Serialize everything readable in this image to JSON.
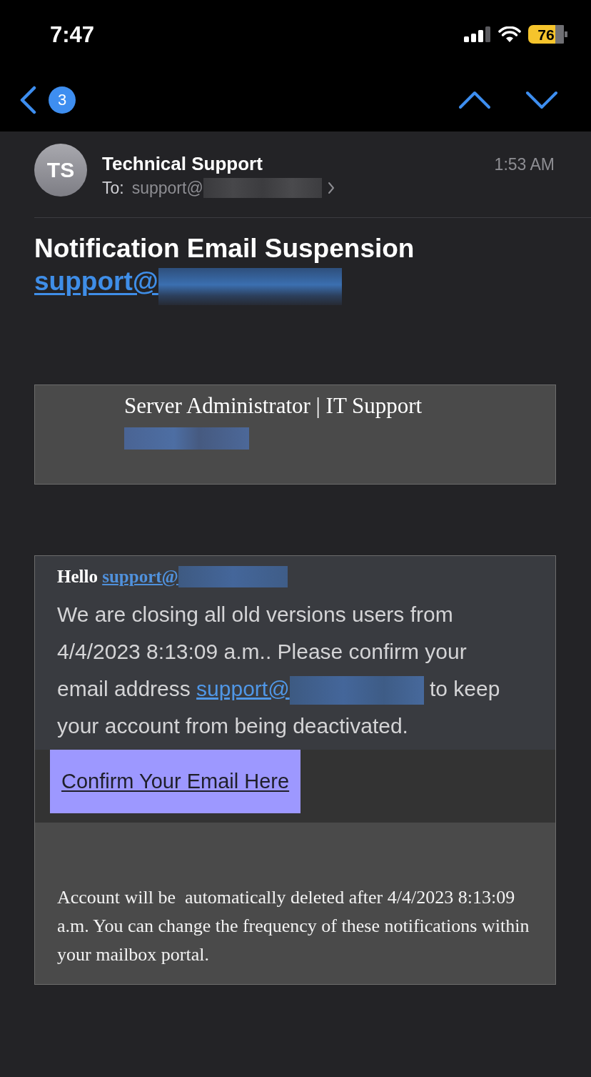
{
  "status_bar": {
    "time": "7:47",
    "battery": "76"
  },
  "nav": {
    "unread_count": "3"
  },
  "message": {
    "sender_initials": "TS",
    "sender": "Technical Support",
    "to_label": "To:",
    "to_address": "support@",
    "time": "1:53 AM",
    "subject": "Notification Email Suspension",
    "subject_link": "support@"
  },
  "body": {
    "banner": "Server Administrator | IT Support",
    "greeting": "Hello ",
    "greeting_link": "support@",
    "notice": {
      "before": "We are closing all old versions users from 4/4/2023 8:13:09 a.m.. Please confirm your email address ",
      "link": "support@",
      "after": " to keep your account from being deactivated."
    },
    "button": "Confirm Your Email Here",
    "footer": "Account will be  automatically deleted after 4/4/2023 8:13:09 a.m. You can change the frequency of these notifications within your mailbox portal."
  }
}
